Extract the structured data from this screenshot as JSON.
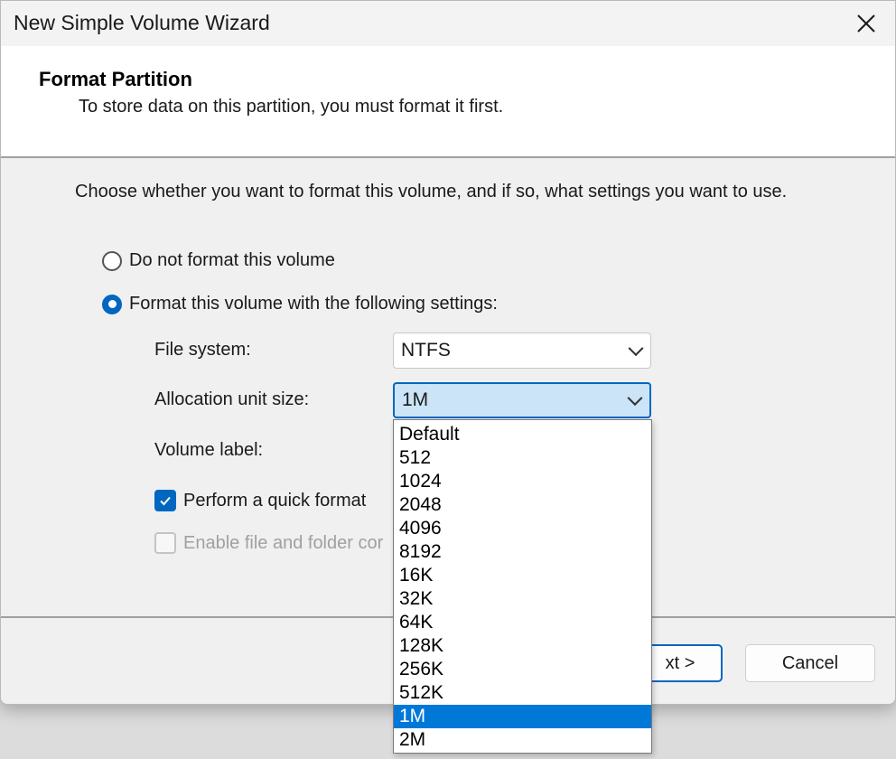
{
  "window": {
    "title": "New Simple Volume Wizard"
  },
  "header": {
    "title": "Format Partition",
    "subtitle": "To store data on this partition, you must format it first."
  },
  "instruction": "Choose whether you want to format this volume, and if so, what settings you want to use.",
  "options": {
    "no_format_label": "Do not format this volume",
    "format_label": "Format this volume with the following settings:",
    "selected": "format"
  },
  "settings": {
    "file_system_label": "File system:",
    "file_system_value": "NTFS",
    "allocation_label": "Allocation unit size:",
    "allocation_value": "1M",
    "volume_label_label": "Volume label:",
    "quick_format_label": "Perform a quick format",
    "quick_format_checked": true,
    "compression_label": "Enable file and folder cor",
    "compression_checked": false,
    "compression_enabled": false
  },
  "allocation_dropdown": {
    "open": true,
    "options": [
      "Default",
      "512",
      "1024",
      "2048",
      "4096",
      "8192",
      "16K",
      "32K",
      "64K",
      "128K",
      "256K",
      "512K",
      "1M",
      "2M"
    ],
    "highlighted": "1M"
  },
  "buttons": {
    "next_label": "xt >",
    "cancel_label": "Cancel"
  },
  "colors": {
    "accent": "#0067c0",
    "highlight": "#0078d7",
    "background": "#f0f0f0"
  }
}
